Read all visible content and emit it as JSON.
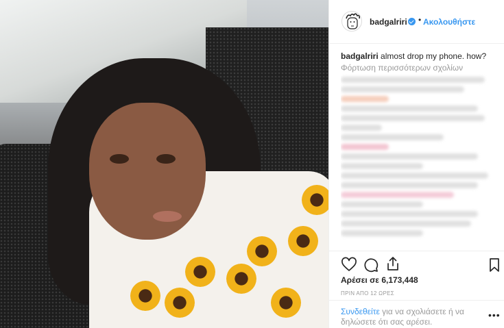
{
  "post": {
    "username": "badgalriri",
    "follow_label": "Ακολουθήστε",
    "separator": "•",
    "caption_user": "badgalriri",
    "caption_text": "almost drop my phone. how?",
    "load_more_comments": "Φόρτωση περισσότερων σχολίων",
    "likes_text": "Αρέσει σε 6,173,448",
    "timestamp": "ΠΡΙΝ ΑΠΟ 12 ΩΡΕΣ",
    "login_link": "Συνδεθείτε",
    "login_text": " για να σχολιάσετε ή να δηλώσετε ότι σας αρέσει.",
    "more_options": "•••"
  },
  "icons": {
    "verified": "verified-badge-icon",
    "like": "heart-icon",
    "comment": "comment-bubble-icon",
    "share": "share-icon",
    "save": "bookmark-icon"
  },
  "colors": {
    "link_blue": "#3897f0",
    "text_dark": "#262626",
    "text_muted": "#999999",
    "divider": "#efefef"
  }
}
